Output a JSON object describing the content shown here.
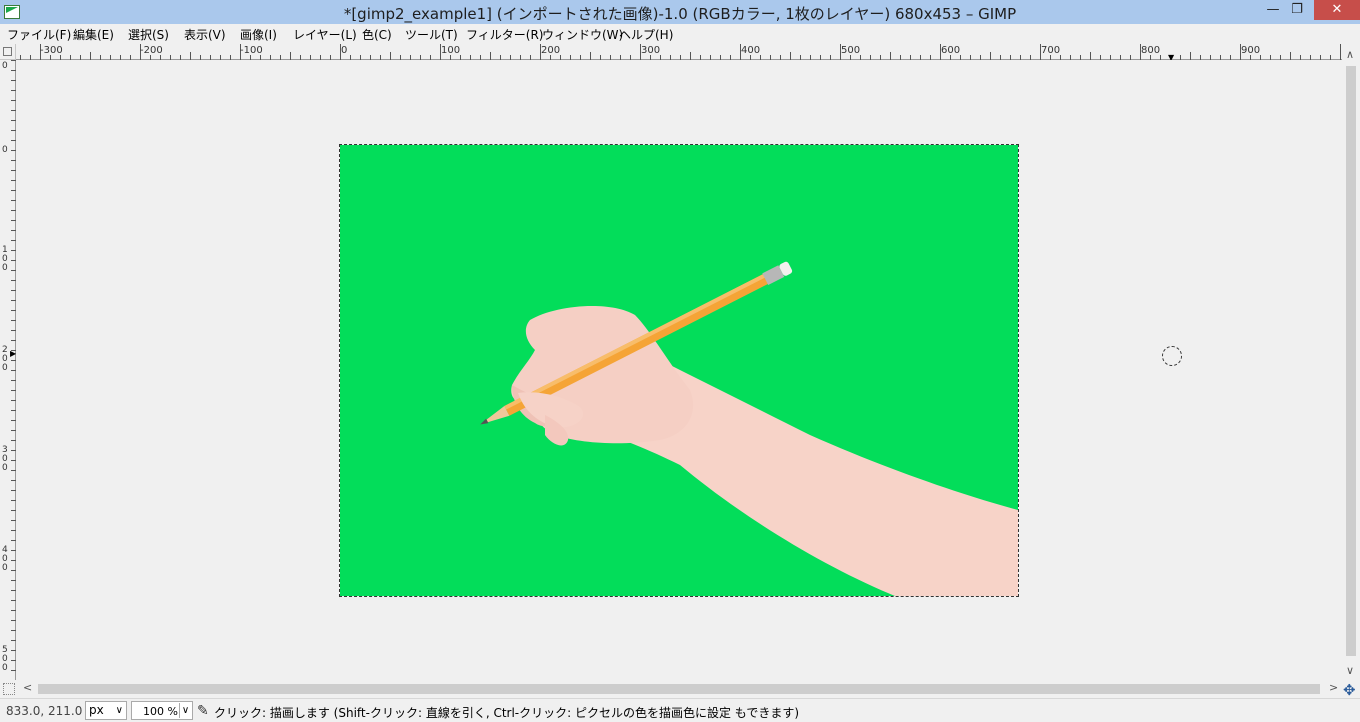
{
  "window": {
    "title": "*[gimp2_example1] (インポートされた画像)-1.0 (RGBカラー, 1枚のレイヤー) 680x453 – GIMP",
    "minimize_icon": "minimize-icon",
    "restore_icon": "restore-icon",
    "close_icon": "close-icon"
  },
  "menu": [
    {
      "label": "ファイル(F)"
    },
    {
      "label": "編集(E)"
    },
    {
      "label": "選択(S)"
    },
    {
      "label": "表示(V)"
    },
    {
      "label": "画像(I)"
    },
    {
      "label": "レイヤー(L)"
    },
    {
      "label": "色(C)"
    },
    {
      "label": "ツール(T)"
    },
    {
      "label": "フィルター(R)"
    },
    {
      "label": "ウィンドウ(W)"
    },
    {
      "label": "ヘルプ(H)"
    }
  ],
  "rulers": {
    "horizontal": [
      "-300",
      "-200",
      "-100",
      "0",
      "100",
      "200",
      "300",
      "400",
      "500",
      "600",
      "700",
      "800",
      "900"
    ],
    "vertical": [
      "0",
      "0",
      "100",
      "200",
      "300",
      "400",
      "500"
    ]
  },
  "canvas": {
    "image_background": "#03dd5a",
    "workspace_background": "#f0f0f0"
  },
  "statusbar": {
    "coords": "833.0, 211.0",
    "unit": "px",
    "zoom": "100 %",
    "message": "クリック: 描画します (Shift-クリック: 直線を引く, Ctrl-クリック: ピクセルの色を描画色に設定 もできます)"
  }
}
